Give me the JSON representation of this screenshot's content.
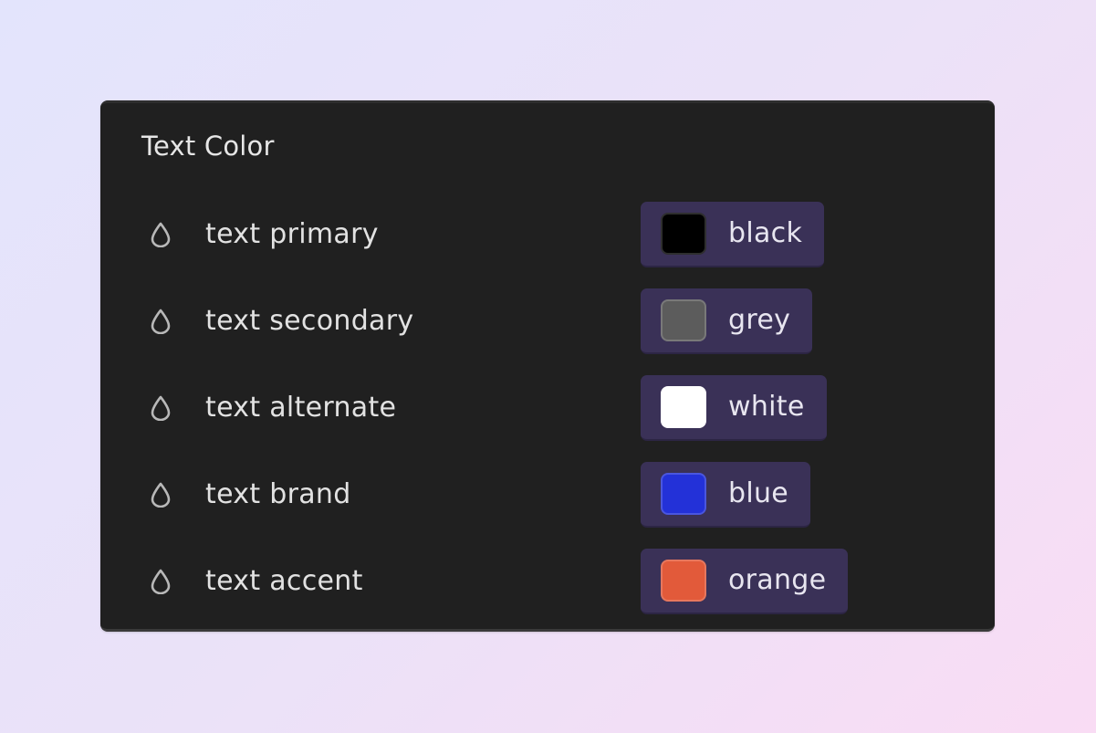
{
  "panel": {
    "title": "Text Color",
    "rows": [
      {
        "icon": "droplet-icon",
        "label": "text primary",
        "value": "black",
        "swatch": "#000000"
      },
      {
        "icon": "droplet-icon",
        "label": "text secondary",
        "value": "grey",
        "swatch": "#5c5c5c"
      },
      {
        "icon": "droplet-icon",
        "label": "text alternate",
        "value": "white",
        "swatch": "#ffffff"
      },
      {
        "icon": "droplet-icon",
        "label": "text brand",
        "value": "blue",
        "swatch": "#2331d8"
      },
      {
        "icon": "droplet-icon",
        "label": "text accent",
        "value": "orange",
        "swatch": "#e25a3a"
      }
    ]
  }
}
